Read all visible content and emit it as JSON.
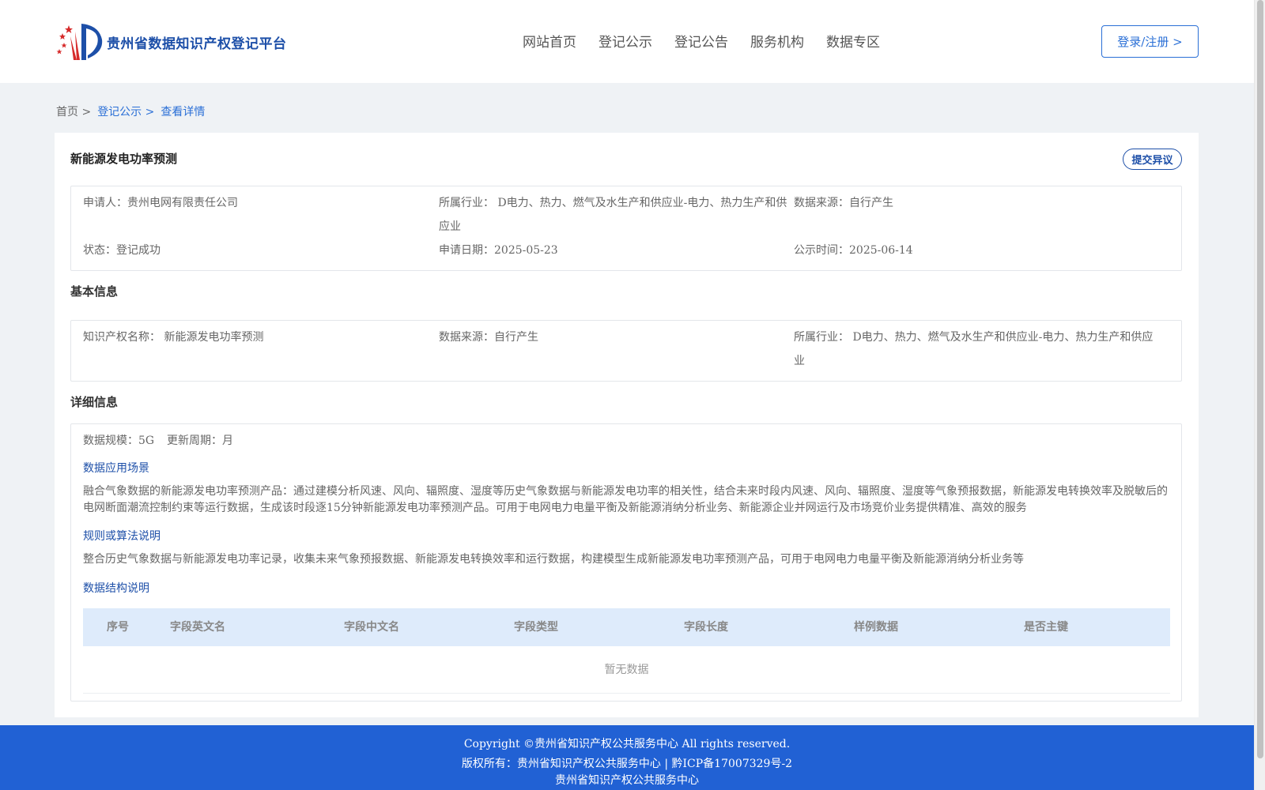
{
  "header": {
    "logo_text": "贵州省数据知识产权登记平台",
    "nav": [
      "网站首页",
      "登记公示",
      "登记公告",
      "服务机构",
      "数据专区"
    ],
    "login_label": "登录/注册 >"
  },
  "breadcrumb": {
    "home": "首页 >",
    "list": "登记公示 >",
    "current": "查看详情"
  },
  "detail": {
    "title": "新能源发电功率预测",
    "objection_label": "提交异议",
    "summary": {
      "applicant": "申请人：贵州电网有限责任公司",
      "industry": "所属行业： D电力、热力、燃气及水生产和供应业-电力、热力生产和供应业",
      "source": "数据来源：自行产生",
      "status": "状态：登记成功",
      "apply_date": "申请日期：2025-05-23",
      "publish_date": "公示时间：2025-06-14"
    },
    "basic": {
      "section_title": "基本信息",
      "ip_name": "知识产权名称： 新能源发电功率预测",
      "source": "数据来源：自行产生",
      "industry": "所属行业： D电力、热力、燃气及水生产和供应业-电力、热力生产和供应业"
    },
    "details": {
      "section_title": "详细信息",
      "scale": "数据规模：5G",
      "cycle": "更新周期：月",
      "scenario_title": "数据应用场景",
      "scenario_text": "融合气象数据的新能源发电功率预测产品：通过建模分析风速、风向、辐照度、湿度等历史气象数据与新能源发电功率的相关性，结合未来时段内风速、风向、辐照度、湿度等气象预报数据，新能源发电转换效率及脱敏后的电网断面潮流控制约束等运行数据，生成该时段逐15分钟新能源发电功率预测产品。可用于电网电力电量平衡及新能源消纳分析业务、新能源企业并网运行及市场竞价业务提供精准、高效的服务",
      "algorithm_title": "规则或算法说明",
      "algorithm_text": "整合历史气象数据与新能源发电功率记录，收集未来气象预报数据、新能源发电转换效率和运行数据，构建模型生成新能源发电功率预测产品，可用于电网电力电量平衡及新能源消纳分析业务等",
      "structure_title": "数据结构说明",
      "table_headers": [
        "序号",
        "字段英文名",
        "字段中文名",
        "字段类型",
        "字段长度",
        "样例数据",
        "是否主键"
      ],
      "empty_text": "暂无数据"
    }
  },
  "footer": {
    "copyright": "Copyright ©贵州省知识产权公共服务中心 All rights reserved.",
    "owner": "版权所有：贵州省知识产权公共服务中心 | 黔ICP备17007329号-2",
    "org": "贵州省知识产权公共服务中心"
  }
}
